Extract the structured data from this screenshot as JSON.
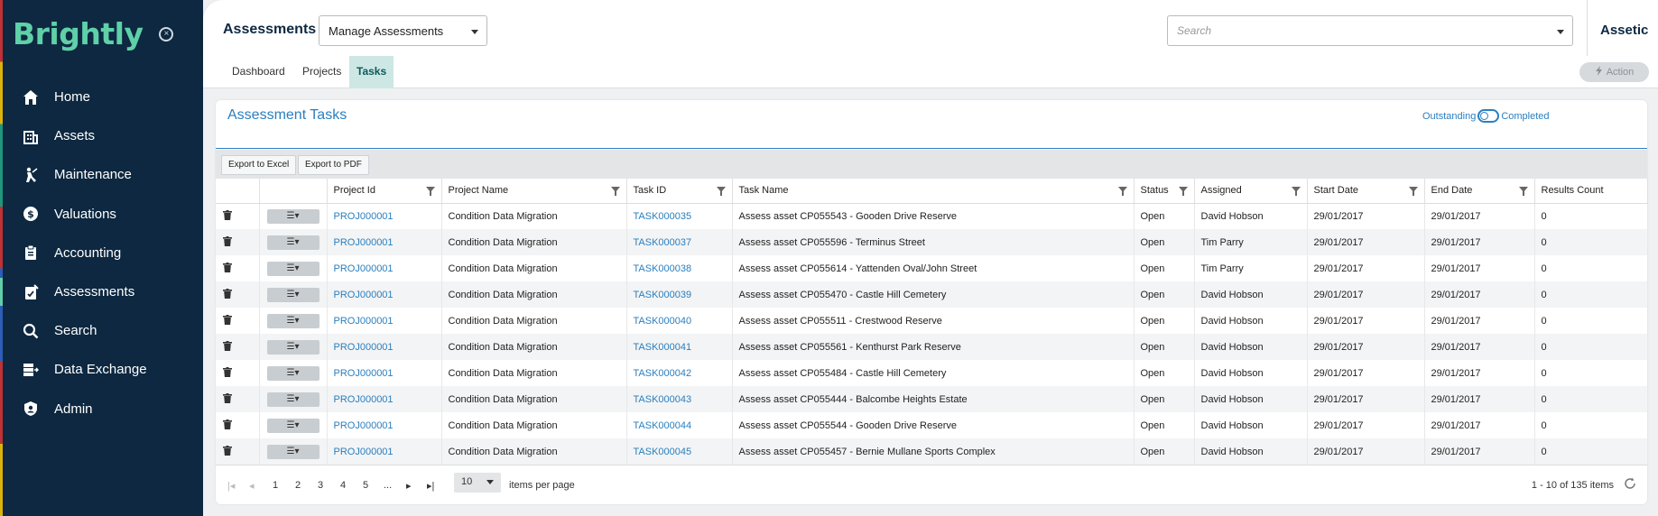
{
  "sidebar": {
    "brand": "Brightly",
    "items": [
      {
        "label": "Home",
        "icon": "home-icon"
      },
      {
        "label": "Assets",
        "icon": "building-icon"
      },
      {
        "label": "Maintenance",
        "icon": "worker-icon"
      },
      {
        "label": "Valuations",
        "icon": "money-icon"
      },
      {
        "label": "Accounting",
        "icon": "clipboard-icon"
      },
      {
        "label": "Assessments",
        "icon": "assessment-icon"
      },
      {
        "label": "Search",
        "icon": "search-icon"
      },
      {
        "label": "Data Exchange",
        "icon": "data-exchange-icon"
      },
      {
        "label": "Admin",
        "icon": "shield-user-icon"
      }
    ],
    "active": "Assessments"
  },
  "header": {
    "title": "Assessments",
    "select_value": "Manage Assessments",
    "search_placeholder": "Search",
    "org": "Assetic"
  },
  "tabs": [
    {
      "label": "Dashboard"
    },
    {
      "label": "Projects"
    },
    {
      "label": "Tasks"
    }
  ],
  "active_tab": "Tasks",
  "action_label": "Action",
  "card": {
    "title": "Assessment Tasks",
    "toggle_left": "Outstanding",
    "toggle_right": "Completed",
    "export_excel": "Export to Excel",
    "export_pdf": "Export to PDF"
  },
  "columns": [
    "Project Id",
    "Project Name",
    "Task ID",
    "Task Name",
    "Status",
    "Assigned",
    "Start Date",
    "End Date",
    "Results Count"
  ],
  "rows": [
    {
      "project_id": "PROJ000001",
      "project_name": "Condition Data Migration",
      "task_id": "TASK000035",
      "task_name": "Assess asset CP055543 - Gooden Drive Reserve",
      "status": "Open",
      "assigned": "David Hobson",
      "start": "29/01/2017",
      "end": "29/01/2017",
      "results": "0"
    },
    {
      "project_id": "PROJ000001",
      "project_name": "Condition Data Migration",
      "task_id": "TASK000037",
      "task_name": "Assess asset CP055596 - Terminus Street",
      "status": "Open",
      "assigned": "Tim Parry",
      "start": "29/01/2017",
      "end": "29/01/2017",
      "results": "0"
    },
    {
      "project_id": "PROJ000001",
      "project_name": "Condition Data Migration",
      "task_id": "TASK000038",
      "task_name": "Assess asset CP055614 - Yattenden Oval/John Street",
      "status": "Open",
      "assigned": "Tim Parry",
      "start": "29/01/2017",
      "end": "29/01/2017",
      "results": "0"
    },
    {
      "project_id": "PROJ000001",
      "project_name": "Condition Data Migration",
      "task_id": "TASK000039",
      "task_name": "Assess asset CP055470 - Castle Hill Cemetery",
      "status": "Open",
      "assigned": "David Hobson",
      "start": "29/01/2017",
      "end": "29/01/2017",
      "results": "0"
    },
    {
      "project_id": "PROJ000001",
      "project_name": "Condition Data Migration",
      "task_id": "TASK000040",
      "task_name": "Assess asset CP055511 - Crestwood Reserve",
      "status": "Open",
      "assigned": "David Hobson",
      "start": "29/01/2017",
      "end": "29/01/2017",
      "results": "0"
    },
    {
      "project_id": "PROJ000001",
      "project_name": "Condition Data Migration",
      "task_id": "TASK000041",
      "task_name": "Assess asset CP055561 - Kenthurst Park Reserve",
      "status": "Open",
      "assigned": "David Hobson",
      "start": "29/01/2017",
      "end": "29/01/2017",
      "results": "0"
    },
    {
      "project_id": "PROJ000001",
      "project_name": "Condition Data Migration",
      "task_id": "TASK000042",
      "task_name": "Assess asset CP055484 - Castle Hill Cemetery",
      "status": "Open",
      "assigned": "David Hobson",
      "start": "29/01/2017",
      "end": "29/01/2017",
      "results": "0"
    },
    {
      "project_id": "PROJ000001",
      "project_name": "Condition Data Migration",
      "task_id": "TASK000043",
      "task_name": "Assess asset CP055444 - Balcombe Heights Estate",
      "status": "Open",
      "assigned": "David Hobson",
      "start": "29/01/2017",
      "end": "29/01/2017",
      "results": "0"
    },
    {
      "project_id": "PROJ000001",
      "project_name": "Condition Data Migration",
      "task_id": "TASK000044",
      "task_name": "Assess asset CP055544 - Gooden Drive Reserve",
      "status": "Open",
      "assigned": "David Hobson",
      "start": "29/01/2017",
      "end": "29/01/2017",
      "results": "0"
    },
    {
      "project_id": "PROJ000001",
      "project_name": "Condition Data Migration",
      "task_id": "TASK000045",
      "task_name": "Assess asset CP055457 - Bernie Mullane Sports Complex",
      "status": "Open",
      "assigned": "David Hobson",
      "start": "29/01/2017",
      "end": "29/01/2017",
      "results": "0"
    }
  ],
  "pager": {
    "pages": [
      "1",
      "2",
      "3",
      "4",
      "5",
      "..."
    ],
    "page_size": "10",
    "per_page_label": "items per page",
    "summary": "1 - 10 of 135 items"
  },
  "colors": {
    "sidebar_bg": "#0d2840",
    "brand": "#5fd0a8",
    "link": "#2a7fbf",
    "tab_active": "#cde7e5"
  }
}
